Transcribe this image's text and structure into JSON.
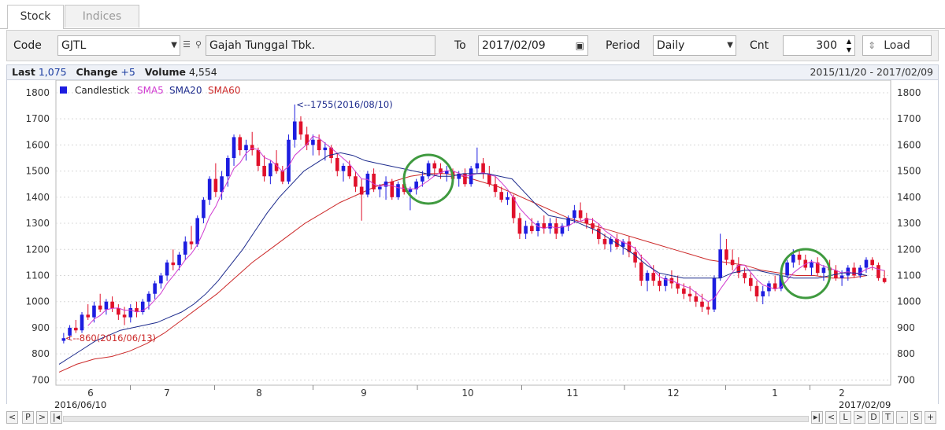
{
  "tabs": [
    {
      "label": "Stock"
    },
    {
      "label": "Indices"
    }
  ],
  "toolbar": {
    "code_label": "Code",
    "code_value": "GJTL",
    "company_name": "Gajah Tunggal Tbk.",
    "to_label": "To",
    "to_value": "2017/02/09",
    "period_label": "Period",
    "period_value": "Daily",
    "cnt_label": "Cnt",
    "cnt_value": "300",
    "load_label": "Load"
  },
  "info": {
    "last_label": "Last",
    "last_value": "1,075",
    "change_label": "Change",
    "change_value": "+5",
    "volume_label": "Volume",
    "volume_value": "4,554",
    "date_range": "2015/11/20 - 2017/02/09"
  },
  "legend": {
    "candlestick": "Candlestick",
    "sma5": "SMA5",
    "sma20": "SMA20",
    "sma60": "SMA60"
  },
  "nav": {
    "start_date": "2016/06/10",
    "end_date": "2017/02/09",
    "left_buttons": [
      "<",
      "P",
      ">",
      "|◂"
    ],
    "right_buttons": [
      "▸|",
      "<",
      "L",
      ">",
      "D",
      "T",
      "-",
      "S",
      "+"
    ]
  },
  "colors": {
    "up": "#1d1de0",
    "down": "#e0102a",
    "sma5": "#d03ad0",
    "sma20": "#1c2a8c",
    "sma60": "#cc2a2a",
    "highlight": "#3f9a3f"
  },
  "chart_data": {
    "type": "candlestick",
    "yticks": [
      700,
      800,
      900,
      1000,
      1100,
      1200,
      1300,
      1400,
      1500,
      1600,
      1700,
      1800
    ],
    "ylim": [
      680,
      1830
    ],
    "xaxis_months": [
      "6",
      "7",
      "8",
      "9",
      "10",
      "11",
      "12",
      "1",
      "2"
    ],
    "annotations": [
      {
        "text": "<--1755(2016/08/10)",
        "value": 1755
      },
      {
        "text": "<--860(2016/06/13)",
        "value": 860
      }
    ],
    "candles": [
      [
        850,
        880,
        840,
        860
      ],
      [
        870,
        910,
        855,
        900
      ],
      [
        900,
        930,
        880,
        890
      ],
      [
        890,
        960,
        880,
        950
      ],
      [
        950,
        990,
        930,
        940
      ],
      [
        940,
        1000,
        920,
        985
      ],
      [
        985,
        1030,
        960,
        970
      ],
      [
        970,
        1010,
        950,
        1000
      ],
      [
        1000,
        1020,
        960,
        975
      ],
      [
        975,
        990,
        930,
        950
      ],
      [
        950,
        980,
        910,
        940
      ],
      [
        940,
        990,
        920,
        975
      ],
      [
        975,
        1000,
        940,
        960
      ],
      [
        960,
        1010,
        950,
        1000
      ],
      [
        1000,
        1040,
        970,
        1030
      ],
      [
        1030,
        1080,
        1010,
        1070
      ],
      [
        1070,
        1110,
        1050,
        1100
      ],
      [
        1100,
        1160,
        1080,
        1150
      ],
      [
        1150,
        1200,
        1120,
        1140
      ],
      [
        1140,
        1190,
        1120,
        1180
      ],
      [
        1180,
        1250,
        1160,
        1230
      ],
      [
        1230,
        1290,
        1200,
        1220
      ],
      [
        1220,
        1330,
        1210,
        1320
      ],
      [
        1320,
        1400,
        1300,
        1390
      ],
      [
        1390,
        1480,
        1370,
        1470
      ],
      [
        1470,
        1530,
        1400,
        1420
      ],
      [
        1420,
        1500,
        1390,
        1480
      ],
      [
        1480,
        1560,
        1440,
        1550
      ],
      [
        1550,
        1640,
        1520,
        1630
      ],
      [
        1630,
        1640,
        1560,
        1580
      ],
      [
        1580,
        1620,
        1540,
        1600
      ],
      [
        1600,
        1650,
        1560,
        1580
      ],
      [
        1580,
        1590,
        1500,
        1520
      ],
      [
        1520,
        1560,
        1460,
        1480
      ],
      [
        1480,
        1540,
        1450,
        1530
      ],
      [
        1530,
        1580,
        1490,
        1500
      ],
      [
        1500,
        1520,
        1450,
        1460
      ],
      [
        1460,
        1640,
        1450,
        1620
      ],
      [
        1620,
        1755,
        1590,
        1690
      ],
      [
        1690,
        1710,
        1620,
        1640
      ],
      [
        1640,
        1670,
        1580,
        1600
      ],
      [
        1600,
        1640,
        1560,
        1620
      ],
      [
        1620,
        1640,
        1560,
        1580
      ],
      [
        1580,
        1610,
        1540,
        1590
      ],
      [
        1590,
        1600,
        1530,
        1550
      ],
      [
        1550,
        1570,
        1480,
        1500
      ],
      [
        1500,
        1530,
        1460,
        1520
      ],
      [
        1520,
        1540,
        1470,
        1480
      ],
      [
        1480,
        1500,
        1420,
        1440
      ],
      [
        1440,
        1470,
        1310,
        1410
      ],
      [
        1410,
        1500,
        1400,
        1490
      ],
      [
        1490,
        1510,
        1420,
        1430
      ],
      [
        1430,
        1450,
        1400,
        1440
      ],
      [
        1440,
        1480,
        1390,
        1460
      ],
      [
        1460,
        1470,
        1390,
        1400
      ],
      [
        1400,
        1460,
        1390,
        1450
      ],
      [
        1450,
        1480,
        1410,
        1420
      ],
      [
        1420,
        1440,
        1350,
        1430
      ],
      [
        1430,
        1470,
        1410,
        1460
      ],
      [
        1460,
        1500,
        1440,
        1480
      ],
      [
        1480,
        1540,
        1470,
        1530
      ],
      [
        1530,
        1540,
        1480,
        1510
      ],
      [
        1510,
        1530,
        1470,
        1490
      ],
      [
        1490,
        1520,
        1460,
        1500
      ],
      [
        1500,
        1510,
        1450,
        1470
      ],
      [
        1470,
        1500,
        1440,
        1490
      ],
      [
        1490,
        1510,
        1440,
        1450
      ],
      [
        1450,
        1520,
        1440,
        1510
      ],
      [
        1510,
        1590,
        1490,
        1530
      ],
      [
        1530,
        1550,
        1470,
        1490
      ],
      [
        1490,
        1520,
        1440,
        1450
      ],
      [
        1450,
        1480,
        1400,
        1420
      ],
      [
        1420,
        1440,
        1380,
        1390
      ],
      [
        1390,
        1420,
        1370,
        1400
      ],
      [
        1400,
        1410,
        1300,
        1320
      ],
      [
        1320,
        1340,
        1240,
        1260
      ],
      [
        1260,
        1310,
        1240,
        1290
      ],
      [
        1290,
        1320,
        1260,
        1270
      ],
      [
        1270,
        1310,
        1250,
        1300
      ],
      [
        1300,
        1330,
        1260,
        1280
      ],
      [
        1280,
        1320,
        1260,
        1300
      ],
      [
        1300,
        1320,
        1240,
        1260
      ],
      [
        1260,
        1300,
        1250,
        1290
      ],
      [
        1290,
        1330,
        1270,
        1320
      ],
      [
        1320,
        1370,
        1300,
        1350
      ],
      [
        1350,
        1380,
        1310,
        1320
      ],
      [
        1320,
        1340,
        1280,
        1300
      ],
      [
        1300,
        1320,
        1260,
        1280
      ],
      [
        1280,
        1300,
        1220,
        1240
      ],
      [
        1240,
        1260,
        1200,
        1220
      ],
      [
        1220,
        1250,
        1190,
        1240
      ],
      [
        1240,
        1260,
        1200,
        1210
      ],
      [
        1210,
        1240,
        1180,
        1230
      ],
      [
        1230,
        1250,
        1170,
        1190
      ],
      [
        1190,
        1210,
        1130,
        1150
      ],
      [
        1150,
        1180,
        1060,
        1080
      ],
      [
        1080,
        1120,
        1040,
        1110
      ],
      [
        1110,
        1140,
        1060,
        1080
      ],
      [
        1080,
        1110,
        1040,
        1060
      ],
      [
        1060,
        1100,
        1040,
        1090
      ],
      [
        1090,
        1120,
        1050,
        1070
      ],
      [
        1070,
        1100,
        1030,
        1050
      ],
      [
        1050,
        1070,
        1010,
        1030
      ],
      [
        1030,
        1060,
        1000,
        1020
      ],
      [
        1020,
        1040,
        980,
        1000
      ],
      [
        1000,
        1030,
        960,
        980
      ],
      [
        980,
        1000,
        950,
        970
      ],
      [
        970,
        1100,
        960,
        1090
      ],
      [
        1090,
        1260,
        1080,
        1200
      ],
      [
        1200,
        1240,
        1140,
        1160
      ],
      [
        1160,
        1200,
        1120,
        1140
      ],
      [
        1140,
        1170,
        1090,
        1110
      ],
      [
        1110,
        1130,
        1070,
        1090
      ],
      [
        1090,
        1110,
        1040,
        1060
      ],
      [
        1060,
        1080,
        1000,
        1020
      ],
      [
        1020,
        1060,
        990,
        1040
      ],
      [
        1040,
        1080,
        1020,
        1070
      ],
      [
        1070,
        1100,
        1040,
        1050
      ],
      [
        1050,
        1110,
        1040,
        1100
      ],
      [
        1100,
        1160,
        1090,
        1150
      ],
      [
        1150,
        1200,
        1130,
        1180
      ],
      [
        1180,
        1200,
        1140,
        1160
      ],
      [
        1160,
        1180,
        1120,
        1130
      ],
      [
        1130,
        1160,
        1100,
        1150
      ],
      [
        1150,
        1170,
        1100,
        1110
      ],
      [
        1110,
        1140,
        1080,
        1130
      ],
      [
        1130,
        1160,
        1100,
        1120
      ],
      [
        1120,
        1140,
        1080,
        1090
      ],
      [
        1090,
        1120,
        1060,
        1100
      ],
      [
        1100,
        1140,
        1080,
        1130
      ],
      [
        1130,
        1150,
        1090,
        1100
      ],
      [
        1100,
        1140,
        1090,
        1130
      ],
      [
        1130,
        1170,
        1110,
        1160
      ],
      [
        1160,
        1170,
        1120,
        1140
      ],
      [
        1140,
        1150,
        1080,
        1090
      ],
      [
        1090,
        1120,
        1070,
        1075
      ]
    ],
    "sma20": [
      760,
      790,
      820,
      850,
      870,
      890,
      900,
      910,
      920,
      940,
      960,
      990,
      1030,
      1080,
      1140,
      1200,
      1270,
      1340,
      1400,
      1450,
      1500,
      1530,
      1560,
      1570,
      1560,
      1540,
      1530,
      1520,
      1510,
      1500,
      1490,
      1480,
      1480,
      1490,
      1490,
      1490,
      1480,
      1470,
      1420,
      1370,
      1330,
      1320,
      1310,
      1290,
      1270,
      1240,
      1210,
      1180,
      1140,
      1110,
      1100,
      1090,
      1090,
      1090,
      1090,
      1110,
      1120,
      1120,
      1110,
      1100,
      1090,
      1090,
      1090,
      1100,
      1110,
      1110,
      1100
    ],
    "sma60": [
      730,
      760,
      780,
      790,
      810,
      840,
      880,
      930,
      980,
      1030,
      1090,
      1150,
      1200,
      1250,
      1300,
      1340,
      1380,
      1410,
      1440,
      1460,
      1480,
      1490,
      1490,
      1480,
      1460,
      1440,
      1410,
      1380,
      1350,
      1320,
      1300,
      1280,
      1260,
      1240,
      1220,
      1200,
      1180,
      1160,
      1150,
      1140,
      1120,
      1110,
      1100,
      1100,
      1090,
      1090,
      1100
    ]
  }
}
